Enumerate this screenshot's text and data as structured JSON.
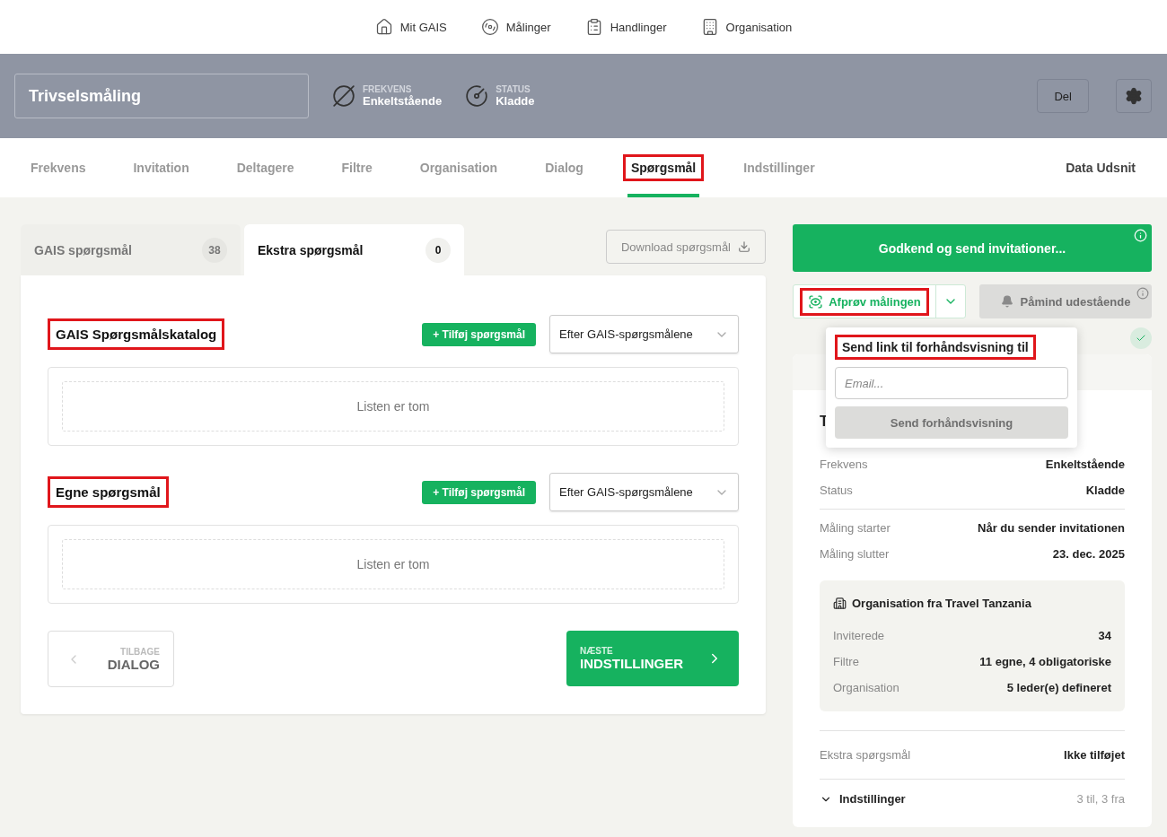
{
  "top_nav": [
    {
      "kind": "home",
      "label": "Mit GAIS"
    },
    {
      "kind": "measure",
      "label": "Målinger"
    },
    {
      "kind": "actions",
      "label": "Handlinger"
    },
    {
      "kind": "org",
      "label": "Organisation"
    }
  ],
  "header": {
    "title": "Trivselsmåling",
    "meta": [
      {
        "kind": "frequency",
        "caption": "FREKVENS",
        "value": "Enkeltstående"
      },
      {
        "kind": "status",
        "caption": "STATUS",
        "value": "Kladde"
      }
    ],
    "share_button": "Del"
  },
  "tabs": [
    {
      "label": "Frekvens",
      "selected": false,
      "annotated": false
    },
    {
      "label": "Invitation",
      "selected": false,
      "annotated": false
    },
    {
      "label": "Deltagere",
      "selected": false,
      "annotated": false
    },
    {
      "label": "Filtre",
      "selected": false,
      "annotated": false
    },
    {
      "label": "Organisation",
      "selected": false,
      "annotated": false
    },
    {
      "label": "Dialog",
      "selected": false,
      "annotated": false
    },
    {
      "label": "Spørgsmål",
      "selected": true,
      "annotated": true
    },
    {
      "label": "Indstillinger",
      "selected": false,
      "annotated": false
    }
  ],
  "data_tab": "Data Udsnit",
  "question_tabs": [
    {
      "label": "GAIS spørgsmål",
      "count": "38",
      "selected": false
    },
    {
      "label": "Ekstra spørgsmål",
      "count": "0",
      "selected": true
    }
  ],
  "download_button": "Download spørgsmål",
  "sections": [
    {
      "title": "GAIS Spørgsmålskatalog",
      "annotated": true,
      "add_button": "+ Tilføj spørgsmål",
      "sort": "Efter GAIS-spørgsmålene",
      "empty_text": "Listen er tom"
    },
    {
      "title": "Egne spørgsmål",
      "annotated": true,
      "add_button": "+ Tilføj spørgsmål",
      "sort": "Efter GAIS-spørgsmålene",
      "empty_text": "Listen er tom"
    }
  ],
  "back": {
    "caption": "TILBAGE",
    "label": "DIALOG"
  },
  "next": {
    "caption": "NÆSTE",
    "label": "INDSTILLINGER"
  },
  "approve_button": "Godkend og send invitationer...",
  "preview_button": {
    "label": "Afprøv målingen",
    "annotated": true
  },
  "remind_button": {
    "label": "Påmind udestående",
    "disabled": true
  },
  "popup": {
    "title": "Send link til forhåndsvisning til",
    "annotated": true,
    "email_placeholder": "Email...",
    "send_button": "Send forhåndsvisning",
    "send_disabled": true
  },
  "summary": {
    "title": "T",
    "groups": [
      [
        {
          "label": "Frekvens",
          "value": "Enkeltstående"
        },
        {
          "label": "Status",
          "value": "Kladde"
        }
      ],
      [
        {
          "label": "Måling starter",
          "value": "Når du sender invitationen"
        },
        {
          "label": "Måling slutter",
          "value": "23. dec. 2025"
        }
      ]
    ],
    "org_box": {
      "title": "Organisation fra Travel Tanzania",
      "rows": [
        {
          "label": "Inviterede",
          "value": "34"
        },
        {
          "label": "Filtre",
          "value": "11 egne, 4 obligatoriske"
        },
        {
          "label": "Organisation",
          "value": "5 leder(e) defineret"
        }
      ]
    },
    "extra": {
      "label": "Ekstra spørgsmål",
      "value": "Ikke tilføjet"
    },
    "settings": {
      "label": "Indstillinger",
      "value": "3 til, 3 fra",
      "expanded": false
    }
  }
}
